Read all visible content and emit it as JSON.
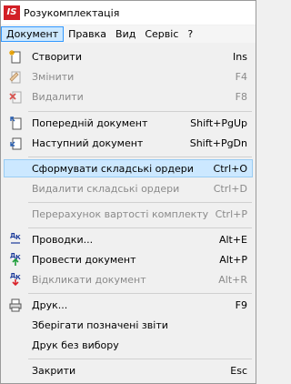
{
  "window": {
    "title": "Розукомплектація",
    "logo_text": "IS"
  },
  "menubar": [
    {
      "label": "Документ"
    },
    {
      "label": "Правка"
    },
    {
      "label": "Вид"
    },
    {
      "label": "Сервіс"
    },
    {
      "label": "?"
    }
  ],
  "menu": {
    "create": {
      "label": "Створити",
      "shortcut": "Ins"
    },
    "edit": {
      "label": "Змінити",
      "shortcut": "F4"
    },
    "delete": {
      "label": "Видалити",
      "shortcut": "F8"
    },
    "prev_doc": {
      "label": "Попередній документ",
      "shortcut": "Shift+PgUp"
    },
    "next_doc": {
      "label": "Наступний документ",
      "shortcut": "Shift+PgDn"
    },
    "form_orders": {
      "label": "Сформувати складські ордери",
      "shortcut": "Ctrl+O"
    },
    "delete_orders": {
      "label": "Видалити складські ордери",
      "shortcut": "Ctrl+D"
    },
    "recalc": {
      "label": "Перерахунок вартості комплекту",
      "shortcut": "Ctrl+P"
    },
    "postings": {
      "label": "Проводки...",
      "shortcut": "Alt+E"
    },
    "post_doc": {
      "label": "Провести документ",
      "shortcut": "Alt+P"
    },
    "unpost_doc": {
      "label": "Відкликати документ",
      "shortcut": "Alt+R"
    },
    "print": {
      "label": "Друк...",
      "shortcut": "F9"
    },
    "save_reports": {
      "label": "Зберігати позначені звіти",
      "shortcut": ""
    },
    "print_nochoice": {
      "label": "Друк без вибору",
      "shortcut": ""
    },
    "close": {
      "label": "Закрити",
      "shortcut": "Esc"
    }
  },
  "icons": {
    "dk_text_top": "Д",
    "dk_text_bottom": "К"
  },
  "colors": {
    "highlight": "#cce8ff",
    "disabled_text": "#8a8a8a",
    "brand": "#d21f26"
  }
}
